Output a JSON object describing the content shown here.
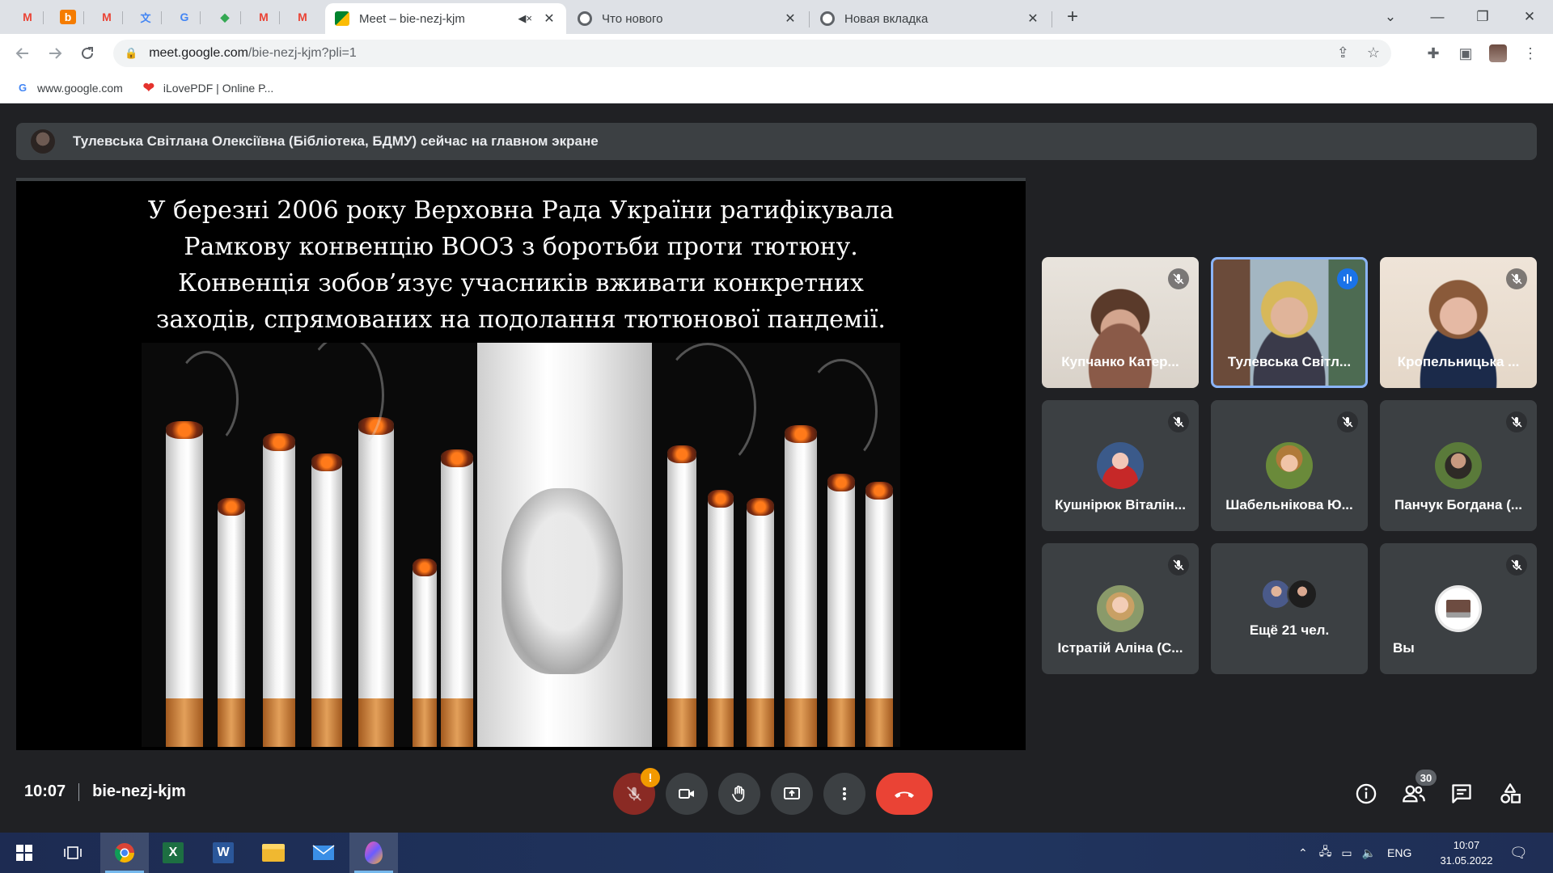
{
  "browser": {
    "pinned_tabs": [
      {
        "icon": "gmail-icon",
        "letter": "M",
        "color": "#ea4335"
      },
      {
        "icon": "blogger-icon",
        "letter": "b",
        "color": "#f57c00"
      },
      {
        "icon": "gmail-icon",
        "letter": "M",
        "color": "#ea4335"
      },
      {
        "icon": "translate-icon",
        "letter": "文",
        "color": "#4285f4"
      },
      {
        "icon": "google-docs-icon",
        "letter": "G",
        "color": "#4285f4"
      },
      {
        "icon": "apps-icon",
        "letter": "◆",
        "color": "#34a853"
      },
      {
        "icon": "gmail-icon",
        "letter": "M",
        "color": "#ea4335"
      },
      {
        "icon": "gmail-icon",
        "letter": "M",
        "color": "#ea4335"
      }
    ],
    "tabs": [
      {
        "title": "Meet – bie-nezj-kjm",
        "active": true
      },
      {
        "title": "Что нового",
        "active": false
      },
      {
        "title": "Новая вкладка",
        "active": false
      }
    ],
    "url_host": "meet.google.com",
    "url_path": "/bie-nezj-kjm?pli=1",
    "bookmarks": [
      {
        "label": "www.google.com"
      },
      {
        "label": "iLovePDF | Online P..."
      }
    ]
  },
  "meet": {
    "banner_text": "Тулевська Світлана Олексіївна (Бібліотека, БДМУ) сейчас на главном экране",
    "slide_lines": [
      "У березні 2006 року Верховна Рада України ратифікувала",
      "Рамкову конвенцію ВООЗ з боротьби проти тютюну.",
      "Конвенція зобов’язує учасників вживати конкретних",
      "заходів, спрямованих на подолання тютюнової пандемії."
    ],
    "participants": [
      {
        "name": "Купчанко Катер..."
      },
      {
        "name": "Тулевська Світл..."
      },
      {
        "name": "Кропельницька ..."
      },
      {
        "name": "Кушнірюк Віталін..."
      },
      {
        "name": "Шабельнікова Ю..."
      },
      {
        "name": "Панчук Богдана (..."
      },
      {
        "name": "Істратій Аліна (С..."
      },
      {
        "name": "Ещё 21 чел."
      },
      {
        "name": "Вы"
      }
    ],
    "time": "10:07",
    "meeting_code": "bie-nezj-kjm",
    "mic_warning": "!",
    "people_count": "30",
    "colors": {
      "hangup": "#ea4335",
      "speaking": "#8ab4f8",
      "muted": "#8a2a24"
    }
  },
  "taskbar": {
    "language": "ENG",
    "clock_time": "10:07",
    "clock_date": "31.05.2022"
  }
}
